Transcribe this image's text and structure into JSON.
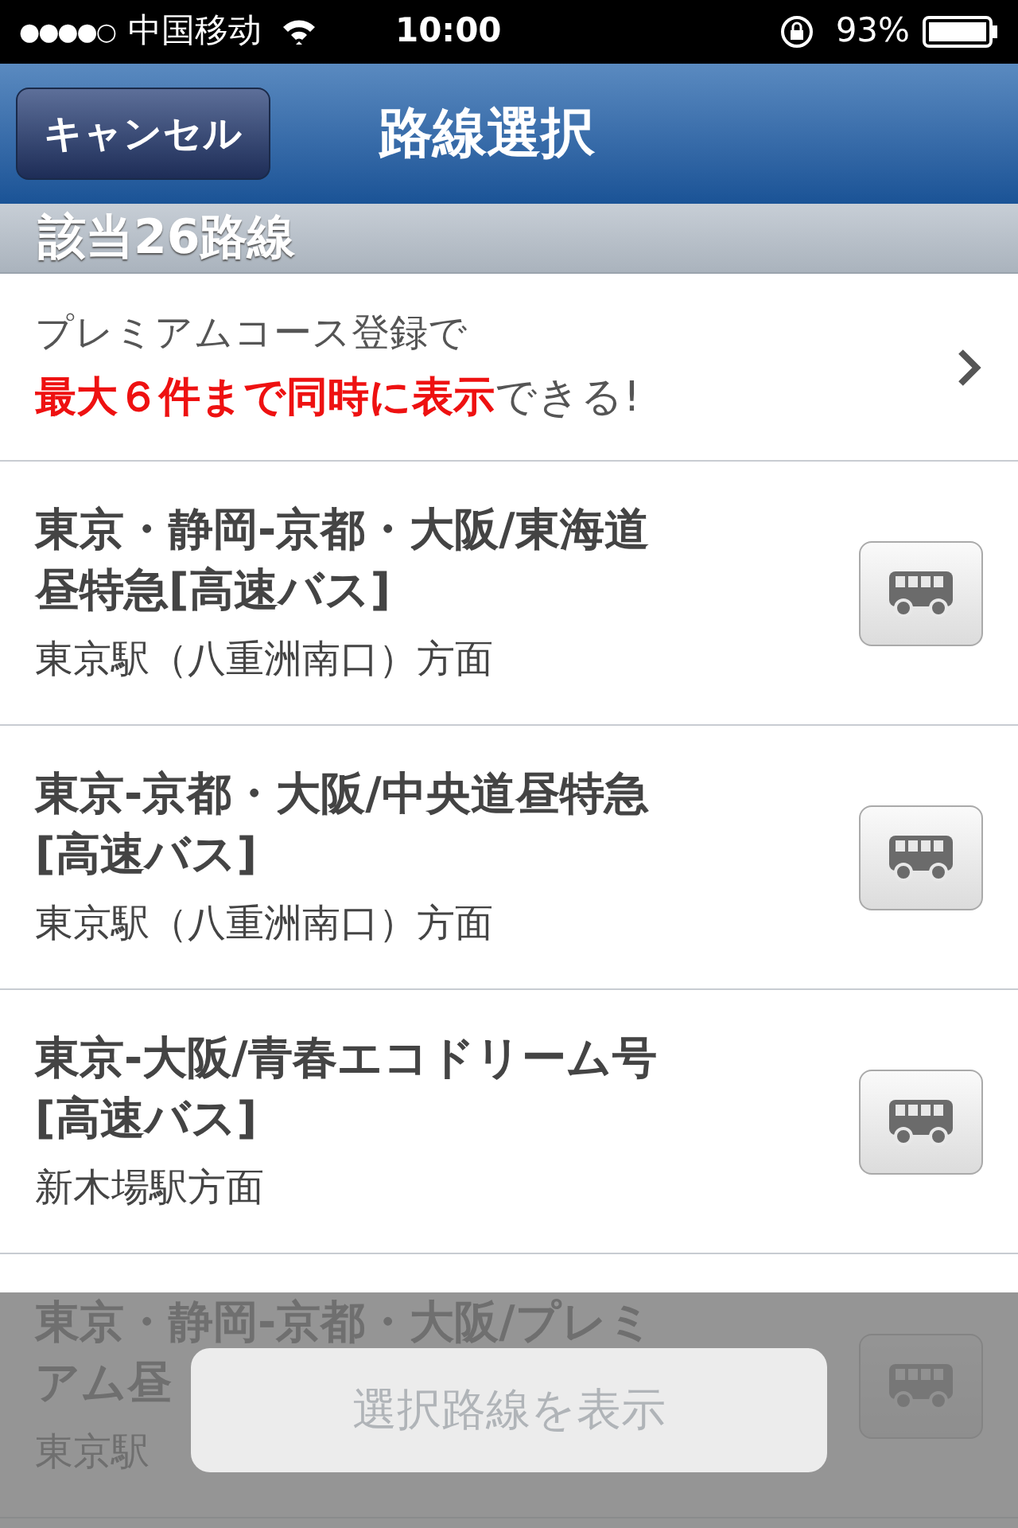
{
  "status_bar": {
    "signal_dots": [
      "●",
      "●",
      "●",
      "●",
      "○"
    ],
    "carrier": "中国移动",
    "time": "10:00",
    "battery": "93%"
  },
  "nav": {
    "cancel": "キャンセル",
    "title": "路線選択"
  },
  "section_header": "該当26路線",
  "promo": {
    "line1": "プレミアムコース登録で",
    "highlight": "最大６件まで同時に表示",
    "rest": "できる!"
  },
  "routes": [
    {
      "lines": [
        "東京・静岡-京都・大阪/東海道",
        "昼特急[高速バス]"
      ],
      "direction": "東京駅（八重洲南口）方面"
    },
    {
      "lines": [
        "東京-京都・大阪/中央道昼特急",
        "[高速バス]"
      ],
      "direction": "東京駅（八重洲南口）方面"
    },
    {
      "lines": [
        "東京-大阪/青春エコドリーム号",
        "[高速バス]"
      ],
      "direction": "新木場駅方面"
    },
    {
      "lines": [
        "東京・静岡-京都・大阪/プレミ",
        "アム昼"
      ],
      "direction": "東京駅"
    }
  ],
  "show_button": {
    "label": "選択路線を表示",
    "disabled": true
  }
}
